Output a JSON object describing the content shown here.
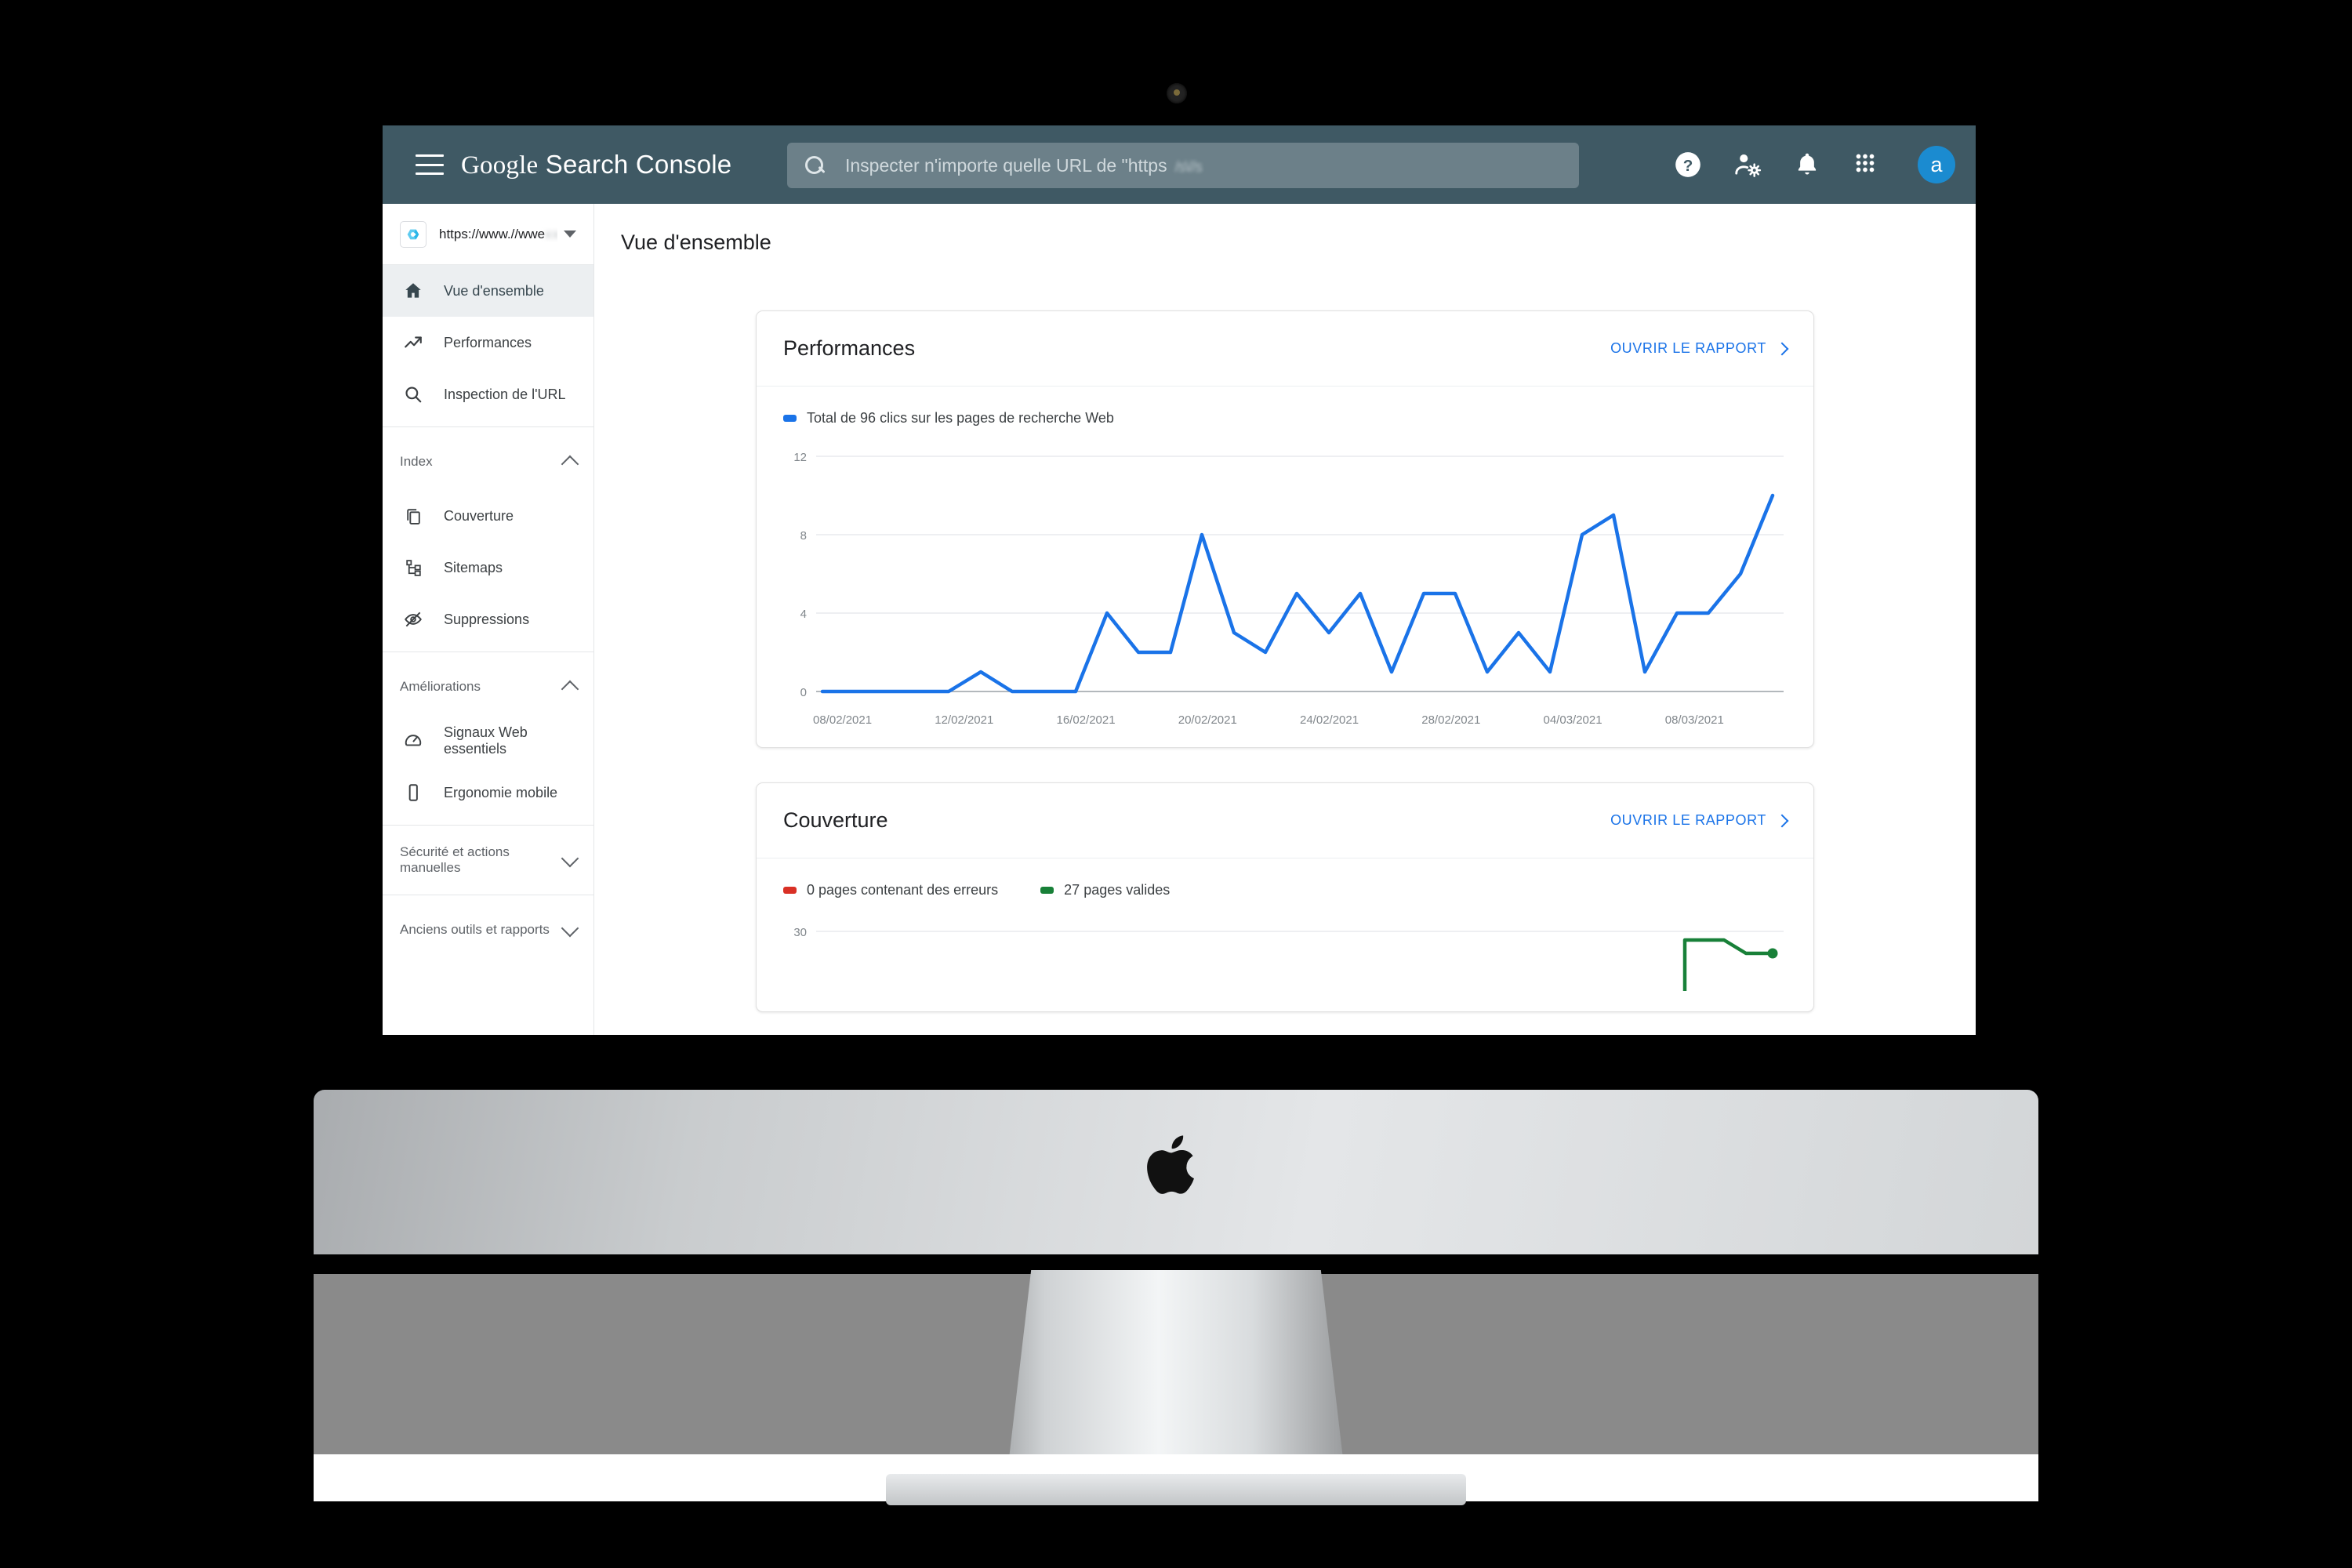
{
  "app": {
    "brand_google": "Google",
    "brand_rest": " Search Console",
    "menu_label": "Menu"
  },
  "search": {
    "placeholder": "Inspecter n'importe quelle URL de \"https",
    "redacted": "/s\\//s",
    "icon": "search-icon"
  },
  "topicons": [
    {
      "name": "help-icon",
      "label": "Aide"
    },
    {
      "name": "user-settings-icon",
      "label": "Paramètres du compte"
    },
    {
      "name": "notifications-bell-icon",
      "label": "Notifications"
    },
    {
      "name": "apps-grid-icon",
      "label": "Applications Google"
    }
  ],
  "avatar": {
    "initial": "a",
    "color": "#1b8bd0"
  },
  "property": {
    "url": "https://www.//wwe",
    "redacted": "xxxxxxx",
    "favicon": "c"
  },
  "sidebar": {
    "items": [
      {
        "label": "Vue d'ensemble",
        "icon": "home-icon",
        "active": true
      },
      {
        "label": "Performances",
        "icon": "trending-up-icon",
        "active": false
      },
      {
        "label": "Inspection de l'URL",
        "icon": "search-icon",
        "active": false
      }
    ],
    "groups": [
      {
        "title": "Index",
        "expanded": true,
        "items": [
          {
            "label": "Couverture",
            "icon": "pages-copy-icon"
          },
          {
            "label": "Sitemaps",
            "icon": "sitemap-icon"
          },
          {
            "label": "Suppressions",
            "icon": "eye-off-icon"
          }
        ]
      },
      {
        "title": "Améliorations",
        "expanded": true,
        "items": [
          {
            "label": "Signaux Web essentiels",
            "icon": "speedometer-icon"
          },
          {
            "label": "Ergonomie mobile",
            "icon": "mobile-phone-icon"
          }
        ]
      },
      {
        "title": "Sécurité et actions manuelles",
        "expanded": false,
        "items": []
      },
      {
        "title": "Anciens outils et rapports",
        "expanded": false,
        "items": []
      }
    ]
  },
  "page": {
    "title": "Vue d'ensemble"
  },
  "cards": {
    "performances": {
      "title": "Performances",
      "link": "OUVRIR LE RAPPORT",
      "legend": "Total de 96 clics sur les pages de recherche Web",
      "legend_color": "#1a73e8"
    },
    "couverture": {
      "title": "Couverture",
      "link": "OUVRIR LE RAPPORT",
      "legend_errors": "0 pages contenant des erreurs",
      "legend_errors_color": "#d93025",
      "legend_valid": "27 pages valides",
      "legend_valid_color": "#188038"
    }
  },
  "chart_data": [
    {
      "type": "line",
      "title": "Total de 96 clics sur les pages de recherche Web",
      "xlabel": "",
      "ylabel": "",
      "ylim": [
        0,
        12
      ],
      "yticks": [
        0,
        4,
        8,
        12
      ],
      "grid": true,
      "legend_position": "top-left",
      "series_color": "#1a73e8",
      "tick_labels": [
        "08/02/2021",
        "12/02/2021",
        "16/02/2021",
        "20/02/2021",
        "24/02/2021",
        "28/02/2021",
        "04/03/2021",
        "08/03/2021"
      ],
      "x": [
        "08/02/2021",
        "09/02/2021",
        "10/02/2021",
        "11/02/2021",
        "12/02/2021",
        "13/02/2021",
        "14/02/2021",
        "15/02/2021",
        "16/02/2021",
        "17/02/2021",
        "18/02/2021",
        "19/02/2021",
        "20/02/2021",
        "21/02/2021",
        "22/02/2021",
        "23/02/2021",
        "24/02/2021",
        "25/02/2021",
        "26/02/2021",
        "27/02/2021",
        "28/02/2021",
        "01/03/2021",
        "02/03/2021",
        "03/03/2021",
        "04/03/2021",
        "05/03/2021",
        "06/03/2021",
        "07/03/2021",
        "08/03/2021",
        "09/03/2021",
        "10/03/2021"
      ],
      "values": [
        0,
        0,
        0,
        0,
        0,
        1,
        0,
        0,
        0,
        4,
        2,
        2,
        8,
        3,
        2,
        5,
        3,
        5,
        1,
        5,
        5,
        1,
        3,
        1,
        8,
        9,
        1,
        4,
        4,
        6,
        10
      ]
    },
    {
      "type": "line",
      "title": "Couverture",
      "ylim": [
        0,
        30
      ],
      "yticks": [
        30
      ],
      "grid": true,
      "legend_position": "top-left",
      "series": [
        {
          "name": "0 pages contenant des erreurs",
          "color": "#d93025",
          "values": [
            0,
            0,
            0,
            0,
            0,
            0,
            0,
            0,
            0,
            0
          ]
        },
        {
          "name": "27 pages valides",
          "color": "#188038",
          "values": [
            0,
            0,
            0,
            0,
            0,
            0,
            0,
            29,
            27,
            27
          ]
        }
      ]
    }
  ]
}
